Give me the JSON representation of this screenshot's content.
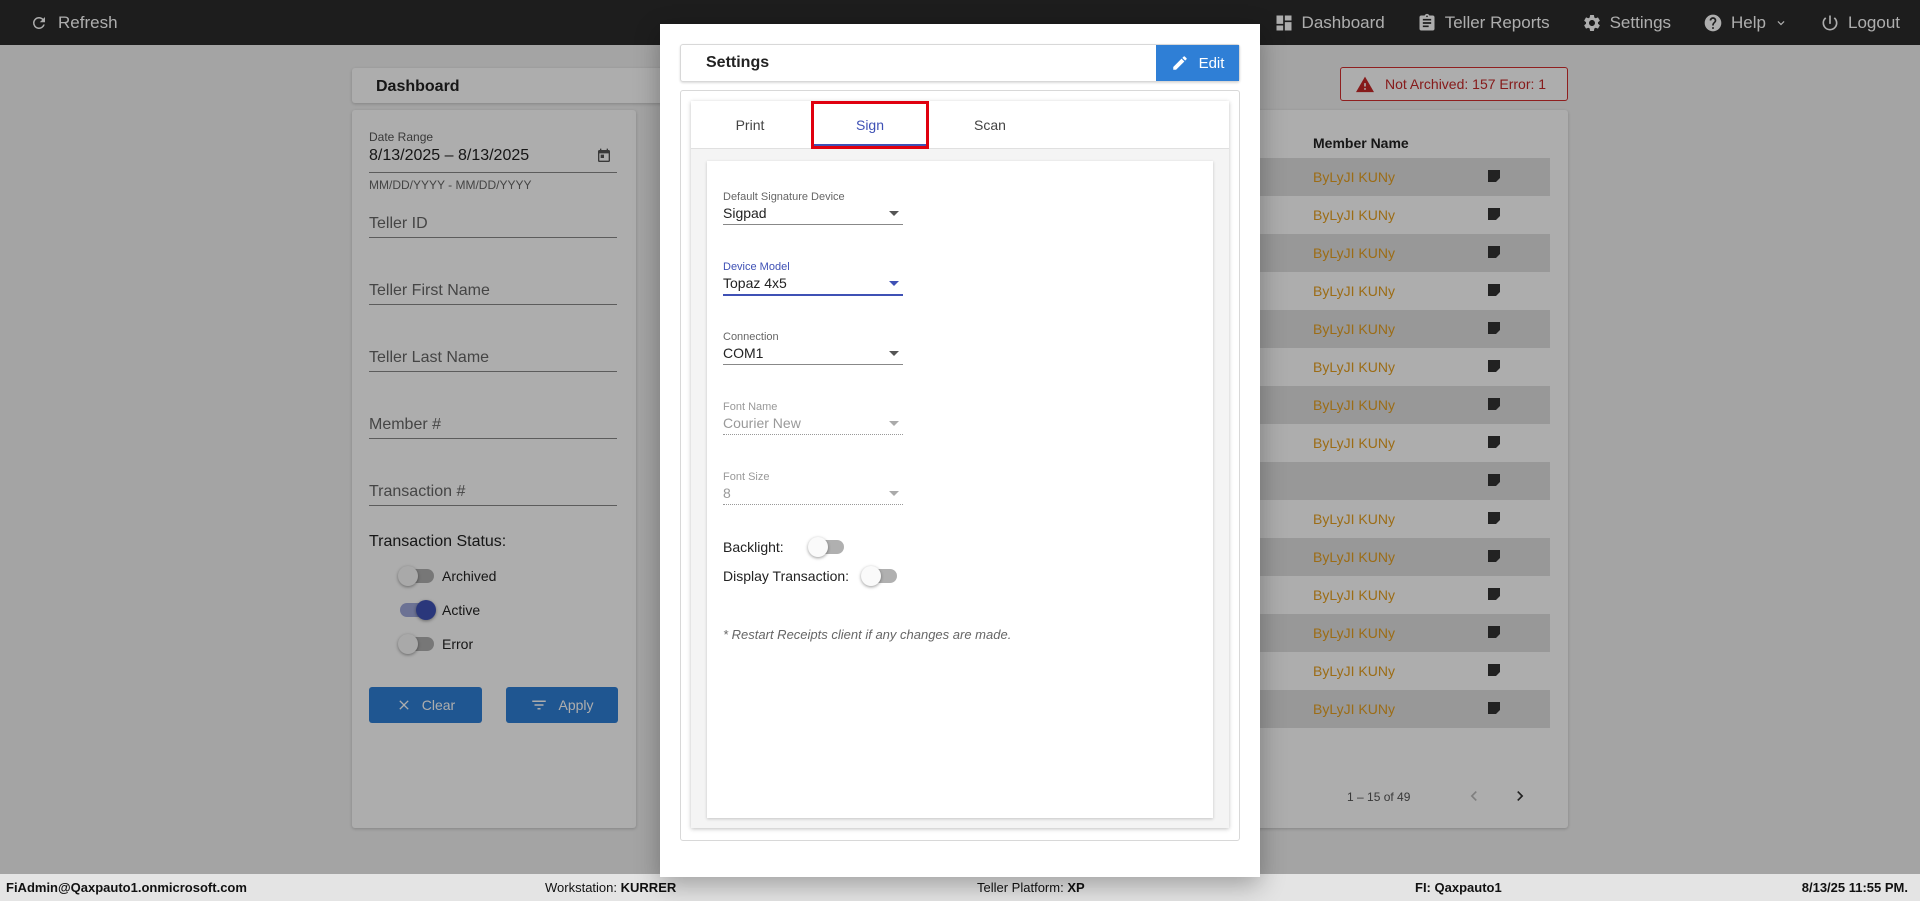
{
  "topbar": {
    "refresh_label": "Refresh",
    "nav": [
      {
        "label": "Dashboard",
        "icon": "dashboard-icon"
      },
      {
        "label": "Teller Reports",
        "icon": "clipboard-icon"
      },
      {
        "label": "Settings",
        "icon": "gear-icon"
      },
      {
        "label": "Help",
        "icon": "help-icon"
      },
      {
        "label": "Logout",
        "icon": "power-icon"
      }
    ]
  },
  "page": {
    "title": "Dashboard",
    "filters": {
      "date_range_label": "Date Range",
      "date_range_value": "8/13/2025 – 8/13/2025",
      "date_hint": "MM/DD/YYYY - MM/DD/YYYY",
      "teller_id": "Teller ID",
      "teller_first_name": "Teller First Name",
      "teller_last_name": "Teller Last Name",
      "member_number": "Member #",
      "transaction_number": "Transaction #",
      "status_title": "Transaction Status:",
      "statuses": [
        {
          "label": "Archived",
          "on": false
        },
        {
          "label": "Active",
          "on": true
        },
        {
          "label": "Error",
          "on": false
        }
      ],
      "clear_label": "Clear",
      "apply_label": "Apply"
    },
    "alert": {
      "text": "Not Archived: 157  Error: 1",
      "color": "#c62828"
    },
    "table": {
      "column_header": "Member Name",
      "rows": [
        "ByLyJI KUNy",
        "ByLyJI KUNy",
        "ByLyJI KUNy",
        "ByLyJI KUNy",
        "ByLyJI KUNy",
        "ByLyJI KUNy",
        "ByLyJI KUNy",
        "ByLyJI KUNy",
        "",
        "ByLyJI KUNy",
        "ByLyJI KUNy",
        "ByLyJI KUNy",
        "ByLyJI KUNy",
        "ByLyJI KUNy",
        "ByLyJI KUNy"
      ],
      "pager_text": "1 – 15 of 49"
    }
  },
  "modal": {
    "title": "Settings",
    "edit_label": "Edit",
    "tabs": [
      "Print",
      "Sign",
      "Scan"
    ],
    "active_tab": "Sign",
    "fields": {
      "signature_device": {
        "label": "Default Signature Device",
        "value": "Sigpad"
      },
      "device_model": {
        "label": "Device Model",
        "value": "Topaz 4x5"
      },
      "connection": {
        "label": "Connection",
        "value": "COM1"
      },
      "font_name": {
        "label": "Font Name",
        "value": "Courier New"
      },
      "font_size": {
        "label": "Font Size",
        "value": "8"
      }
    },
    "backlight_label": "Backlight:",
    "display_transaction_label": "Display Transaction:",
    "note": "* Restart Receipts client if any changes are made."
  },
  "footer": {
    "user": "FiAdmin@Qaxpauto1.onmicrosoft.com",
    "workstation_label": "Workstation:",
    "workstation_value": "KURRER",
    "platform_label": "Teller Platform:",
    "platform_value": "XP",
    "fi_label": "FI:",
    "fi_value": "Qaxpauto1",
    "datetime": "8/13/25 11:55 PM."
  },
  "colors": {
    "accent": "#3f51b5",
    "button_blue": "#2f7fd6",
    "member_link": "#e6a020",
    "highlight_red": "#e0000f"
  }
}
